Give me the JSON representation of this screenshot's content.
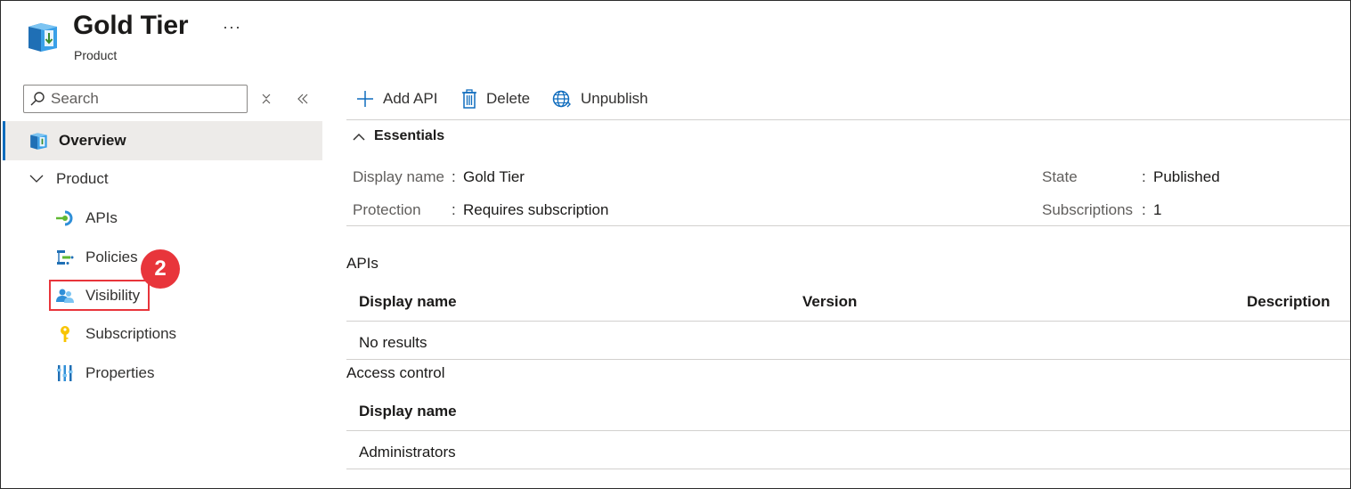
{
  "header": {
    "title": "Gold Tier",
    "more_label": "···",
    "subtitle": "Product"
  },
  "sidebar": {
    "search_placeholder": "Search",
    "overview_label": "Overview",
    "group_label": "Product",
    "items": [
      {
        "label": "APIs",
        "icon": "api-icon"
      },
      {
        "label": "Policies",
        "icon": "policies-icon"
      },
      {
        "label": "Visibility",
        "icon": "users-icon"
      },
      {
        "label": "Subscriptions",
        "icon": "key-icon"
      },
      {
        "label": "Properties",
        "icon": "properties-icon"
      }
    ],
    "step_badge": "2"
  },
  "toolbar": {
    "add_api": "Add API",
    "delete": "Delete",
    "unpublish": "Unpublish"
  },
  "essentials": {
    "toggle_label": "Essentials",
    "display_name_label": "Display name",
    "display_name_value": "Gold Tier",
    "protection_label": "Protection",
    "protection_value": "Requires subscription",
    "state_label": "State",
    "state_value": "Published",
    "subscriptions_label": "Subscriptions",
    "subscriptions_value": "1"
  },
  "apis_section": {
    "title": "APIs",
    "columns": [
      "Display name",
      "Version",
      "Description"
    ],
    "empty_text": "No results"
  },
  "access_section": {
    "title": "Access control",
    "columns": [
      "Display name"
    ],
    "rows": [
      "Administrators"
    ]
  },
  "colors": {
    "accent": "#0f6cbd",
    "highlight": "#e8353b"
  }
}
